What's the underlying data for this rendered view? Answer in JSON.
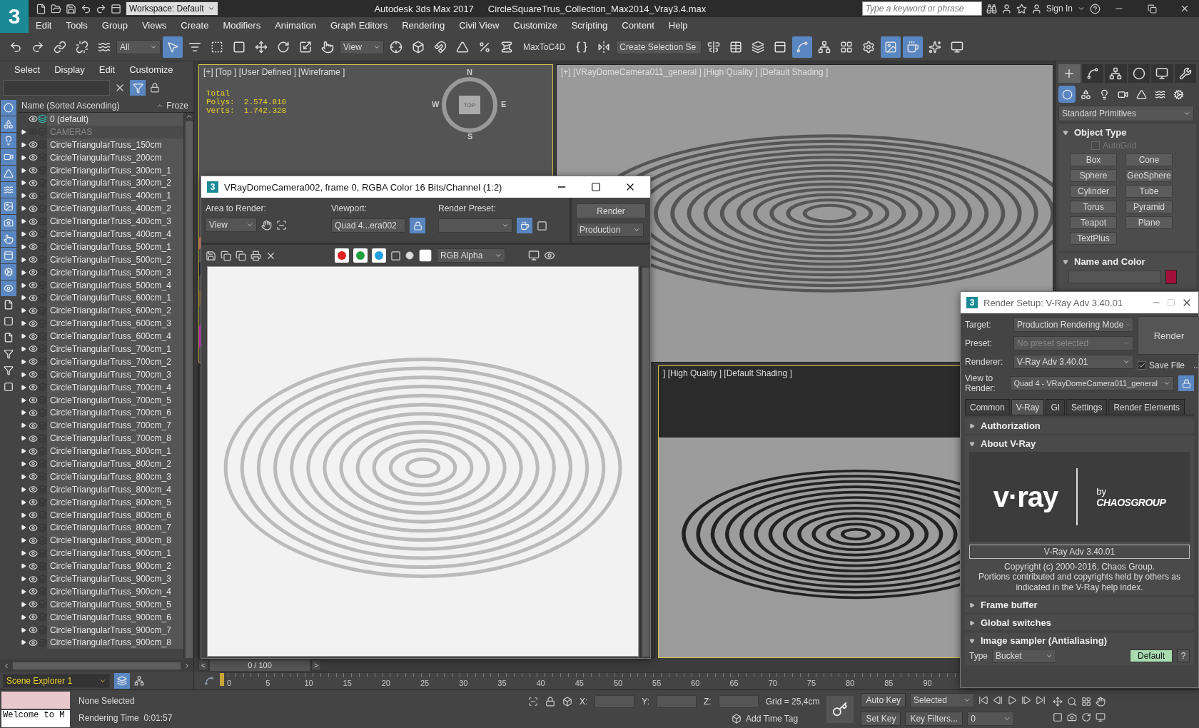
{
  "app": {
    "logo": "3",
    "title": "Autodesk 3ds Max 2017",
    "file": "CircleSquareTrus_Collection_Max2014_Vray3.4.max",
    "workspace": "Workspace: Default",
    "search": {
      "placeholder": "Type a keyword or phrase"
    },
    "sign_in": "Sign In"
  },
  "menu": [
    "Edit",
    "Tools",
    "Group",
    "Views",
    "Create",
    "Modifiers",
    "Animation",
    "Graph Editors",
    "Rendering",
    "Civil View",
    "Customize",
    "Scripting",
    "Content",
    "Help"
  ],
  "toolbar": [
    {
      "kind": "icon",
      "active": false
    },
    {
      "kind": "icon",
      "active": false
    },
    {
      "kind": "icon",
      "active": false
    },
    {
      "kind": "icon",
      "active": false
    },
    {
      "kind": "icon",
      "active": false
    },
    {
      "kind": "dropdown",
      "value": "All"
    },
    {
      "kind": "icon",
      "active": true
    },
    {
      "kind": "icon",
      "active": false
    },
    {
      "kind": "icon",
      "active": false
    },
    {
      "kind": "icon",
      "active": false
    },
    {
      "kind": "icon",
      "active": false
    },
    {
      "kind": "icon",
      "active": false
    },
    {
      "kind": "icon",
      "active": false
    },
    {
      "kind": "icon",
      "active": false
    },
    {
      "kind": "dropdown",
      "value": "View"
    },
    {
      "kind": "icon",
      "active": false
    },
    {
      "kind": "icon",
      "active": false
    },
    {
      "kind": "icon",
      "active": false
    },
    {
      "kind": "icon",
      "active": false
    },
    {
      "kind": "icon",
      "active": false
    },
    {
      "kind": "icon",
      "active": false
    },
    {
      "kind": "label",
      "value": "MaxToC4D"
    },
    {
      "kind": "icon",
      "active": false
    },
    {
      "kind": "icon",
      "active": false
    },
    {
      "kind": "dropdown",
      "value": "Create Selection Se"
    },
    {
      "kind": "icon",
      "active": false
    },
    {
      "kind": "icon",
      "active": false
    },
    {
      "kind": "icon",
      "active": false
    },
    {
      "kind": "icon",
      "active": false
    },
    {
      "kind": "icon",
      "active": true
    },
    {
      "kind": "icon",
      "active": false
    },
    {
      "kind": "icon",
      "active": false
    },
    {
      "kind": "icon",
      "active": false
    },
    {
      "kind": "icon",
      "active": true
    },
    {
      "kind": "icon",
      "active": true
    },
    {
      "kind": "icon",
      "active": false
    },
    {
      "kind": "icon",
      "active": false
    }
  ],
  "scene_explorer": {
    "menus": [
      "Select",
      "Display",
      "Edit",
      "Customize"
    ],
    "filters": [
      {
        "active": true
      },
      {
        "active": true
      },
      {
        "active": true
      },
      {
        "active": true
      },
      {
        "active": true
      },
      {
        "active": true
      },
      {
        "active": true
      },
      {
        "active": true
      },
      {
        "active": true
      },
      {
        "active": true
      },
      {
        "active": true
      },
      {
        "active": true
      },
      {
        "active": false
      },
      {
        "active": false
      },
      {
        "active": false
      },
      {
        "active": false
      },
      {
        "active": false
      },
      {
        "active": false
      }
    ],
    "columns": [
      "Name (Sorted Ascending)",
      "Froze"
    ],
    "rows": [
      {
        "name": "0 (default)",
        "kind": "default",
        "hidden": false
      },
      {
        "name": "CAMERAS",
        "kind": "layer",
        "hidden": true
      },
      {
        "name": "CircleTriangularTruss_150cm",
        "kind": "layer",
        "hidden": false
      },
      {
        "name": "CircleTriangularTruss_200cm",
        "kind": "layer",
        "hidden": false
      },
      {
        "name": "CircleTriangularTruss_300cm_1",
        "kind": "layer",
        "hidden": false
      },
      {
        "name": "CircleTriangularTruss_300cm_2",
        "kind": "layer",
        "hidden": false
      },
      {
        "name": "CircleTriangularTruss_400cm_1",
        "kind": "layer",
        "hidden": false
      },
      {
        "name": "CircleTriangularTruss_400cm_2",
        "kind": "layer",
        "hidden": false
      },
      {
        "name": "CircleTriangularTruss_400cm_3",
        "kind": "layer",
        "hidden": false
      },
      {
        "name": "CircleTriangularTruss_400cm_4",
        "kind": "layer",
        "hidden": false
      },
      {
        "name": "CircleTriangularTruss_500cm_1",
        "kind": "layer",
        "hidden": false
      },
      {
        "name": "CircleTriangularTruss_500cm_2",
        "kind": "layer",
        "hidden": false
      },
      {
        "name": "CircleTriangularTruss_500cm_3",
        "kind": "layer",
        "hidden": false
      },
      {
        "name": "CircleTriangularTruss_500cm_4",
        "kind": "layer",
        "hidden": false
      },
      {
        "name": "CircleTriangularTruss_600cm_1",
        "kind": "layer",
        "hidden": false
      },
      {
        "name": "CircleTriangularTruss_600cm_2",
        "kind": "layer",
        "hidden": false
      },
      {
        "name": "CircleTriangularTruss_600cm_3",
        "kind": "layer",
        "hidden": false
      },
      {
        "name": "CircleTriangularTruss_600cm_4",
        "kind": "layer",
        "hidden": false
      },
      {
        "name": "CircleTriangularTruss_700cm_1",
        "kind": "layer",
        "hidden": false
      },
      {
        "name": "CircleTriangularTruss_700cm_2",
        "kind": "layer",
        "hidden": false
      },
      {
        "name": "CircleTriangularTruss_700cm_3",
        "kind": "layer",
        "hidden": false
      },
      {
        "name": "CircleTriangularTruss_700cm_4",
        "kind": "layer",
        "hidden": false
      },
      {
        "name": "CircleTriangularTruss_700cm_5",
        "kind": "layer",
        "hidden": false
      },
      {
        "name": "CircleTriangularTruss_700cm_6",
        "kind": "layer",
        "hidden": false
      },
      {
        "name": "CircleTriangularTruss_700cm_7",
        "kind": "layer",
        "hidden": false
      },
      {
        "name": "CircleTriangularTruss_700cm_8",
        "kind": "layer",
        "hidden": false
      },
      {
        "name": "CircleTriangularTruss_800cm_1",
        "kind": "layer",
        "hidden": false
      },
      {
        "name": "CircleTriangularTruss_800cm_2",
        "kind": "layer",
        "hidden": false
      },
      {
        "name": "CircleTriangularTruss_800cm_3",
        "kind": "layer",
        "hidden": false
      },
      {
        "name": "CircleTriangularTruss_800cm_4",
        "kind": "layer",
        "hidden": false
      },
      {
        "name": "CircleTriangularTruss_800cm_5",
        "kind": "layer",
        "hidden": false
      },
      {
        "name": "CircleTriangularTruss_800cm_6",
        "kind": "layer",
        "hidden": false
      },
      {
        "name": "CircleTriangularTruss_800cm_7",
        "kind": "layer",
        "hidden": false
      },
      {
        "name": "CircleTriangularTruss_800cm_8",
        "kind": "layer",
        "hidden": false
      },
      {
        "name": "CircleTriangularTruss_900cm_1",
        "kind": "layer",
        "hidden": false
      },
      {
        "name": "CircleTriangularTruss_900cm_2",
        "kind": "layer",
        "hidden": false
      },
      {
        "name": "CircleTriangularTruss_900cm_3",
        "kind": "layer",
        "hidden": false
      },
      {
        "name": "CircleTriangularTruss_900cm_4",
        "kind": "layer",
        "hidden": false
      },
      {
        "name": "CircleTriangularTruss_900cm_5",
        "kind": "layer",
        "hidden": false
      },
      {
        "name": "CircleTriangularTruss_900cm_6",
        "kind": "layer",
        "hidden": false
      },
      {
        "name": "CircleTriangularTruss_900cm_7",
        "kind": "layer",
        "hidden": false
      },
      {
        "name": "CircleTriangularTruss_900cm_8",
        "kind": "layer",
        "hidden": false
      }
    ],
    "footer": "Scene Explorer 1"
  },
  "viewports": [
    {
      "kind": "wireframe",
      "label": "[+] [Top ] [User Defined ] [Wireframe ]",
      "active": true,
      "stats": [
        "Total",
        "Polys:  2.574.816",
        "Verts:  1.742.328"
      ],
      "viewcube": {
        "top": "TOP",
        "north": "N",
        "south": "S",
        "east": "E",
        "west": "W"
      }
    },
    {
      "kind": "shaded",
      "label": "[+] [VRayDomeCamera011_general ] [High Quality ] [Default Shading ]",
      "active": false
    },
    {
      "kind": "hidden",
      "active": false
    },
    {
      "kind": "render",
      "label": "] [High Quality ] [Default Shading ]",
      "active": true
    }
  ],
  "command_panel": {
    "tabs": [
      {
        "selected": true
      },
      {
        "selected": false
      },
      {
        "selected": false
      },
      {
        "selected": false
      },
      {
        "selected": false
      },
      {
        "selected": false
      }
    ],
    "categories": [
      {
        "selected": true
      },
      {
        "selected": false
      },
      {
        "selected": false
      },
      {
        "selected": false
      },
      {
        "selected": false
      },
      {
        "selected": false
      },
      {
        "selected": false
      }
    ],
    "type": "Standard Primitives",
    "object_type": {
      "title": "Object Type",
      "expanded": true,
      "autogrid": {
        "label": "AutoGrid",
        "checked": false,
        "disabled": true
      },
      "buttons": [
        "Box",
        "Cone",
        "Sphere",
        "GeoSphere",
        "Cylinder",
        "Tube",
        "Torus",
        "Pyramid",
        "Teapot",
        "Plane",
        "TextPlus"
      ]
    },
    "name_color": {
      "title": "Name and Color",
      "expanded": true
    }
  },
  "frame_window": {
    "logo": "3",
    "title": "VRayDomeCamera002, frame 0, RGBA Color 16 Bits/Channel (1:2)",
    "area_label": "Area to Render:",
    "area": "View",
    "viewport_label": "Viewport:",
    "viewport": "Quad 4...era002",
    "preset_label": "Render Preset:",
    "render": "Render",
    "mode": "Production",
    "channels": [
      {
        "color": "#e02020",
        "selected": true
      },
      {
        "color": "#20a040",
        "selected": true
      },
      {
        "color": "#20a0e0",
        "selected": true
      }
    ],
    "display": "RGB Alpha"
  },
  "render_setup": {
    "logo": "3",
    "title": "Render Setup: V-Ray Adv 3.40.01",
    "fields": [
      {
        "label": "Target:",
        "value": "Production Rendering Mode",
        "disabled": false
      },
      {
        "label": "Preset:",
        "value": "No preset selected",
        "disabled": true
      },
      {
        "label": "Renderer:",
        "value": "V-Ray Adv 3.40.01",
        "disabled": false
      }
    ],
    "render": "Render",
    "save_file": {
      "label": "Save File",
      "checked": true
    },
    "more": "...",
    "view_label": "View to Render:",
    "view": "Quad 4 - VRayDomeCamera011_general",
    "tabs": [
      {
        "label": "Common",
        "selected": false
      },
      {
        "label": "V-Ray",
        "selected": true
      },
      {
        "label": "GI",
        "selected": false
      },
      {
        "label": "Settings",
        "selected": false
      },
      {
        "label": "Render Elements",
        "selected": false
      }
    ],
    "rollouts": [
      {
        "kind": "plain",
        "title": "Authorization",
        "expanded": false
      },
      {
        "kind": "about",
        "title": "About V-Ray",
        "expanded": true,
        "logo": "v·ray",
        "by": "by",
        "company": "CHAOSGROUP",
        "version": "V-Ray Adv 3.40.01",
        "copyright": "Copyright (c) 2000-2016, Chaos Group.\nPortions contributed and copyrights held by others as indicated in the V-Ray help index."
      },
      {
        "kind": "plain",
        "title": "Frame buffer",
        "expanded": false
      },
      {
        "kind": "plain",
        "title": "Global switches",
        "expanded": false
      },
      {
        "kind": "sampler",
        "title": "Image sampler (Antialiasing)",
        "expanded": true,
        "type_label": "Type",
        "type": "Bucket",
        "default": "Default",
        "help": "?"
      }
    ]
  },
  "timeline": {
    "counter": "0 / 100",
    "prev": "<",
    "next": ">",
    "ticks": [
      "0",
      "5",
      "10",
      "15",
      "20",
      "25",
      "30",
      "35",
      "40",
      "45",
      "50",
      "55",
      "60",
      "65",
      "70",
      "75",
      "80",
      "85",
      "90"
    ]
  },
  "status": {
    "listener": "Welcome to M",
    "selection": "None Selected",
    "render_time": "Rendering Time  0:01:57",
    "x": "X:",
    "y": "Y:",
    "z": "Z:",
    "grid": "Grid = 25,4cm",
    "time_tag": "Add Time Tag",
    "auto_key": "Auto Key",
    "key_mode": "Selected",
    "set_key": "Set Key",
    "key_filters": "Key Filters...",
    "frame": "0"
  }
}
